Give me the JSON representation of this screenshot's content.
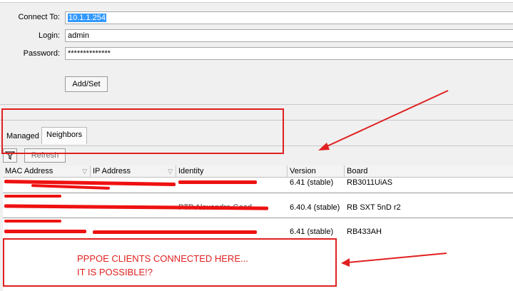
{
  "form": {
    "connect_to_label": "Connect To:",
    "connect_to_value": "10.1.1.254",
    "login_label": "Login:",
    "login_value": "admin",
    "password_label": "Password:",
    "password_value": "**************",
    "add_set_label": "Add/Set"
  },
  "tabs": [
    {
      "label": "Managed",
      "active": false
    },
    {
      "label": "Neighbors",
      "active": true
    }
  ],
  "toolbar": {
    "filter_icon": "filter-icon",
    "refresh_label": "Refresh"
  },
  "table": {
    "columns": [
      "MAC Address",
      "IP Address",
      "Identity",
      "Version",
      "Board"
    ],
    "rows": [
      {
        "mac": "",
        "ip": "",
        "identity": "",
        "version": "6.41 (stable)",
        "board": "RB3011UiAS"
      },
      {
        "group": "",
        "mac": "",
        "ip": "",
        "identity": "PTP Alexandre Goad",
        "version": "6.40.4 (stable)",
        "board": "RB SXT 5nD r2"
      },
      {
        "group": "",
        "mac": "",
        "ip": "",
        "identity": "",
        "version": "6.41 (stable)",
        "board": "RB433AH"
      }
    ]
  },
  "annotation": {
    "line1": "PPPOE CLIENTS CONNECTED HERE...",
    "line2": "IT IS POSSIBLE!?",
    "color": "#e02020"
  },
  "colors": {
    "selection": "#3399ff",
    "annotation_red": "#e02020",
    "background": "#f0f0f0"
  }
}
